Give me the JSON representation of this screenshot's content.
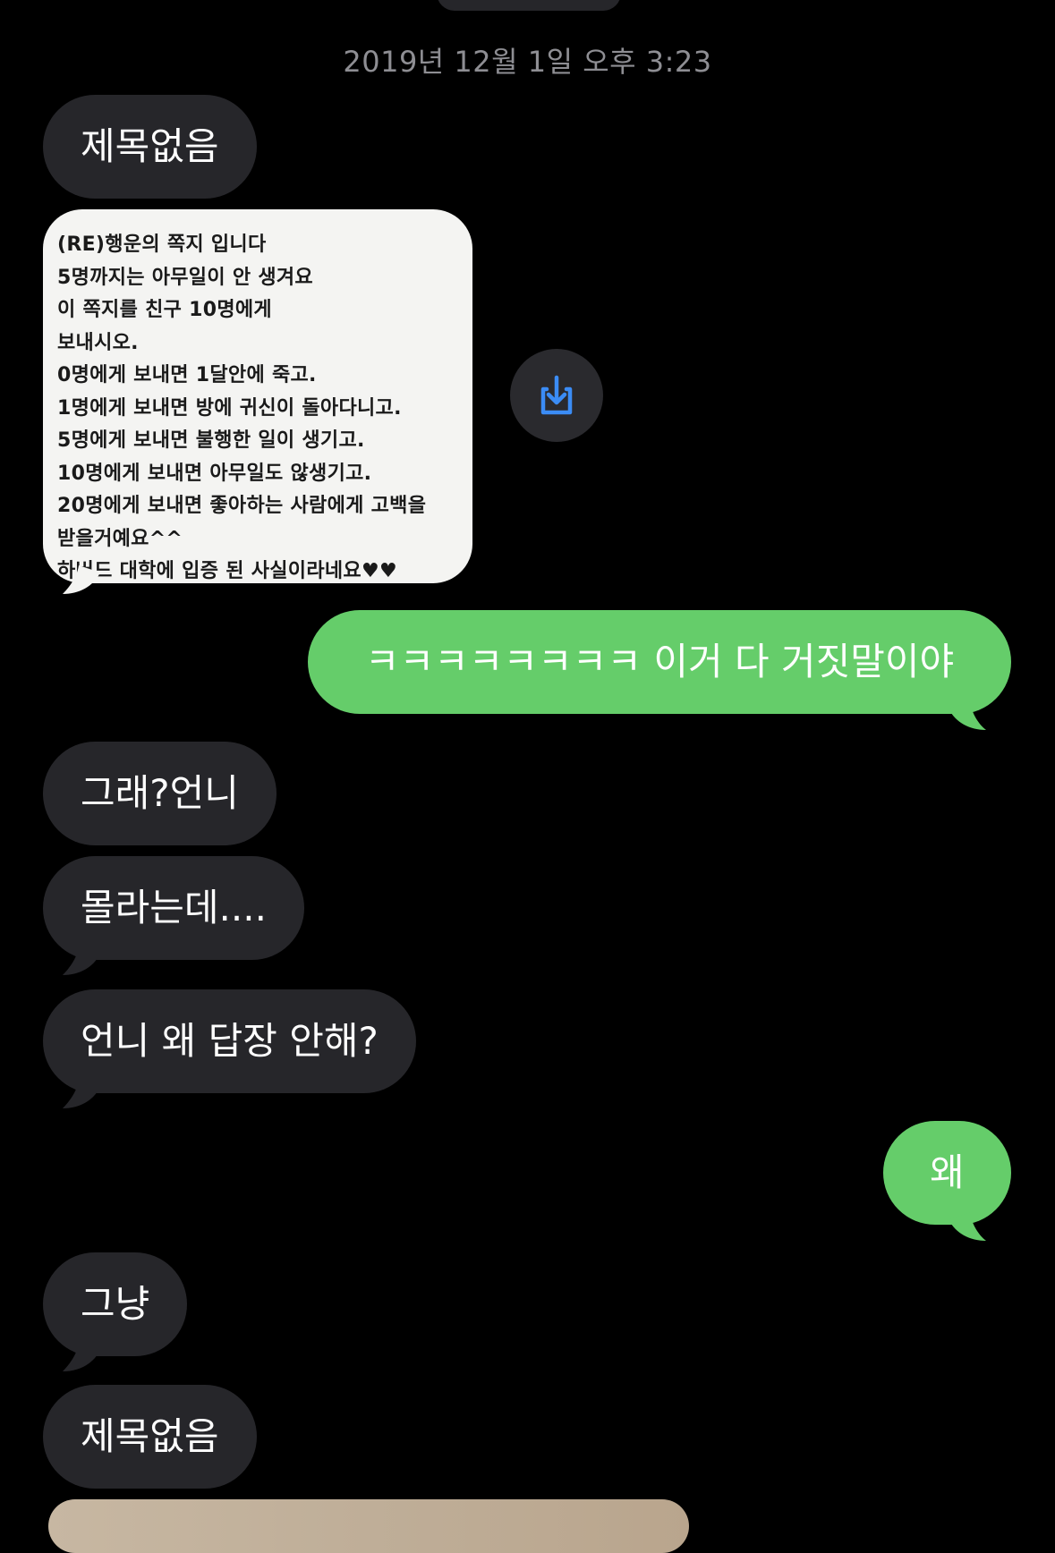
{
  "conversation": {
    "timestamp": "2019년 12월 1일 오후 3:23",
    "messages": [
      {
        "id": "m1",
        "direction": "in",
        "text": "제목없음"
      },
      {
        "id": "m2",
        "direction": "in",
        "type": "image",
        "image_text": [
          "(RE)행운의 쪽지 입니다",
          "5명까지는 아무일이 안 생겨요",
          "이 쪽지를 친구 10명에게",
          "보내시오.",
          "0명에게 보내면 1달안에 죽고.",
          "1명에게 보내면 방에 귀신이 돌아다니고.",
          "5명에게 보내면 불행한 일이 생기고.",
          "10명에게 보내면 아무일도 않생기고.",
          "20명에게 보내면 좋아하는 사람에게 고백을",
          "받을거예요^^",
          "하버드 대학에 입증 된 사실이라네요♥♥"
        ]
      },
      {
        "id": "m3",
        "direction": "out",
        "text": "ㅋㅋㅋㅋㅋㅋㅋㅋ 이거 다 거짓말이야"
      },
      {
        "id": "m4",
        "direction": "in",
        "text": "그래?언니"
      },
      {
        "id": "m5",
        "direction": "in",
        "text": "몰라는데...."
      },
      {
        "id": "m6",
        "direction": "in",
        "text": "언니 왜 답장 안해?"
      },
      {
        "id": "m7",
        "direction": "out",
        "text": "왜"
      },
      {
        "id": "m8",
        "direction": "in",
        "text": "그냥"
      },
      {
        "id": "m9",
        "direction": "in",
        "text": "제목없음"
      }
    ]
  },
  "icons": {
    "save": "download-icon"
  },
  "colors": {
    "background": "#000000",
    "incoming_bubble": "#26262a",
    "outgoing_bubble": "#65cd6a",
    "timestamp": "#8e8e93",
    "save_icon": "#3b8cf5"
  }
}
